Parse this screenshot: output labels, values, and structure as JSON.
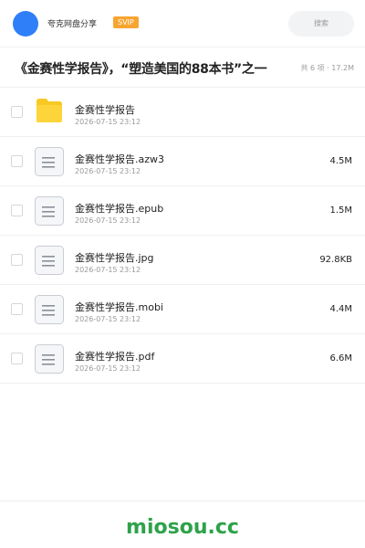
{
  "header": {
    "app_name": "夸克网盘分享",
    "badge": "SVIP",
    "search_placeholder": "搜索",
    "accent_color": "#2f7ff8",
    "badge_color": "#f7a531"
  },
  "share": {
    "title": "《金赛性学报告》，“塑造美国的88本书”之一",
    "summary": "共 6 项 · 17.2M"
  },
  "files": [
    {
      "name": "金赛性学报告",
      "date": "2026-07-15 23:12",
      "size": "",
      "icon": "folder-icon"
    },
    {
      "name": "金赛性学报告.azw3",
      "date": "2026-07-15 23:12",
      "size": "4.5M",
      "icon": "document-icon"
    },
    {
      "name": "金赛性学报告.epub",
      "date": "2026-07-15 23:12",
      "size": "1.5M",
      "icon": "document-icon"
    },
    {
      "name": "金赛性学报告.jpg",
      "date": "2026-07-15 23:12",
      "size": "92.8KB",
      "icon": "document-icon"
    },
    {
      "name": "金赛性学报告.mobi",
      "date": "2026-07-15 23:12",
      "size": "4.4M",
      "icon": "document-icon"
    },
    {
      "name": "金赛性学报告.pdf",
      "date": "2026-07-15 23:12",
      "size": "6.6M",
      "icon": "document-icon"
    }
  ],
  "footer": {
    "watermark": "miosou.cc",
    "watermark_color": "#2ea24a"
  }
}
